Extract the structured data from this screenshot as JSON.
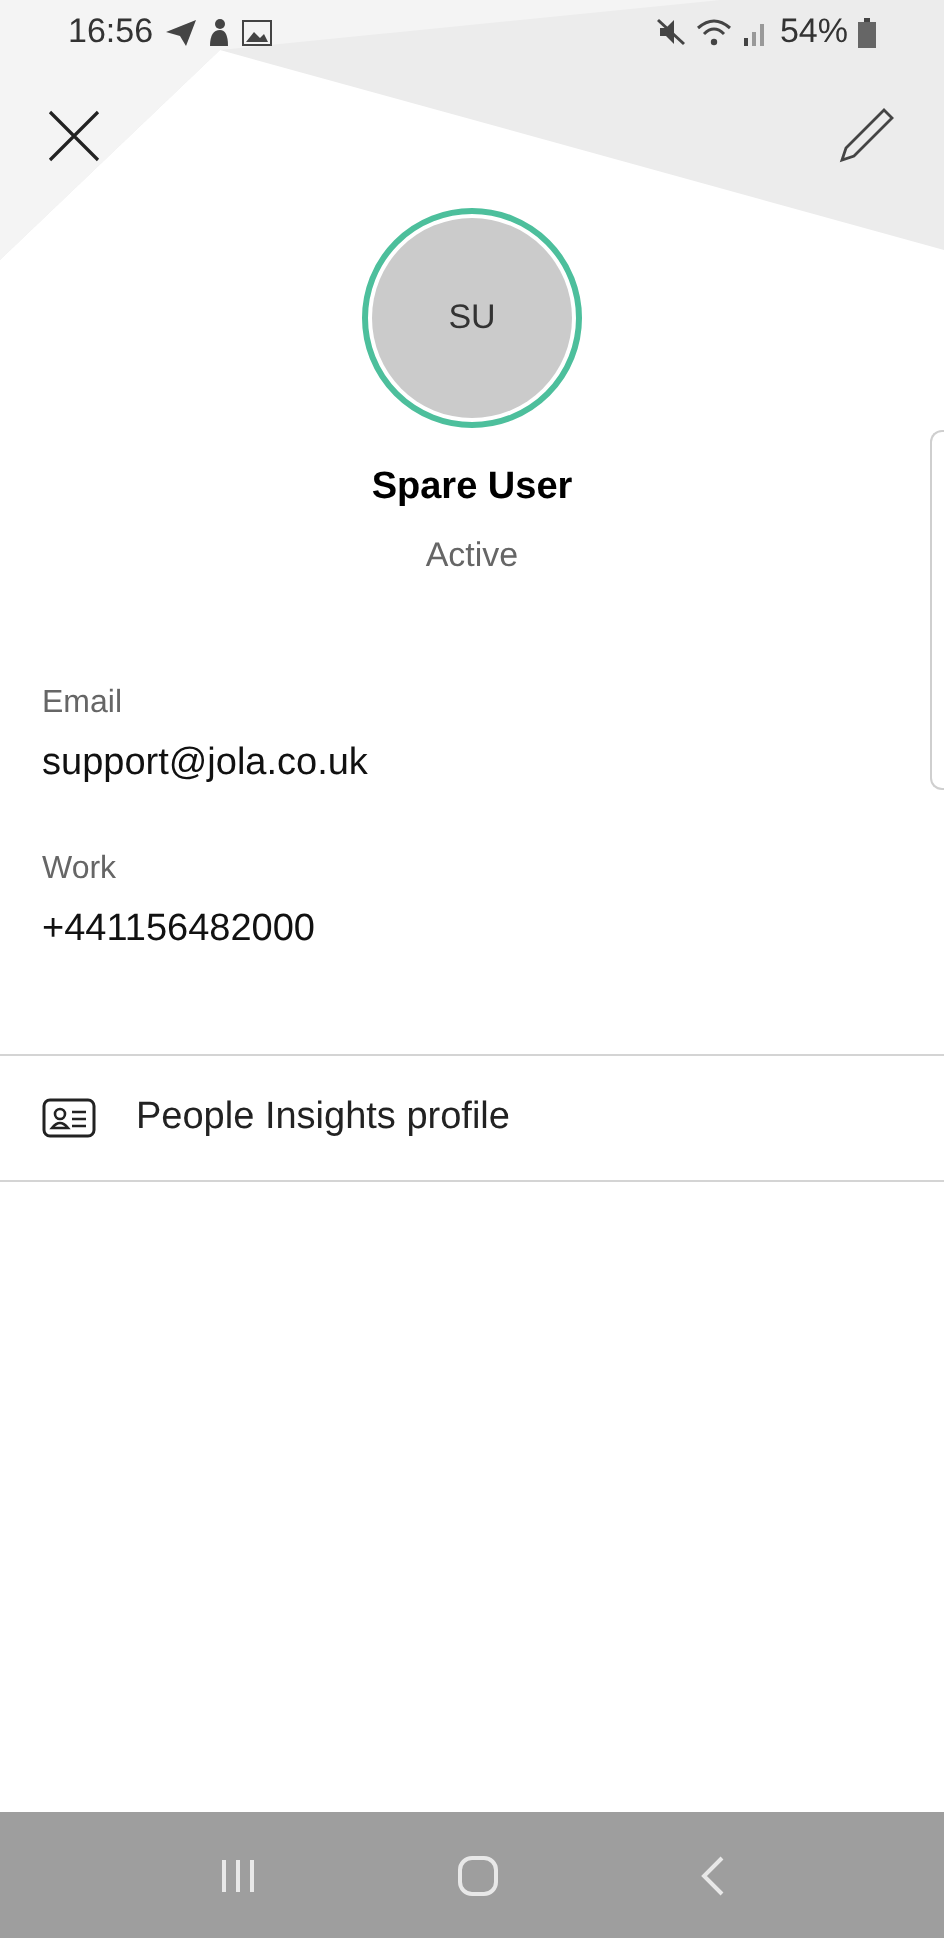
{
  "status_bar": {
    "time": "16:56",
    "battery": "54%"
  },
  "profile": {
    "initials": "SU",
    "name": "Spare User",
    "presence": "Active",
    "available": true
  },
  "fields": [
    {
      "label": "Email",
      "value": "support@jola.co.uk"
    },
    {
      "label": "Work",
      "value": "+441156482000"
    }
  ],
  "links": [
    {
      "label": "People Insights profile"
    }
  ]
}
